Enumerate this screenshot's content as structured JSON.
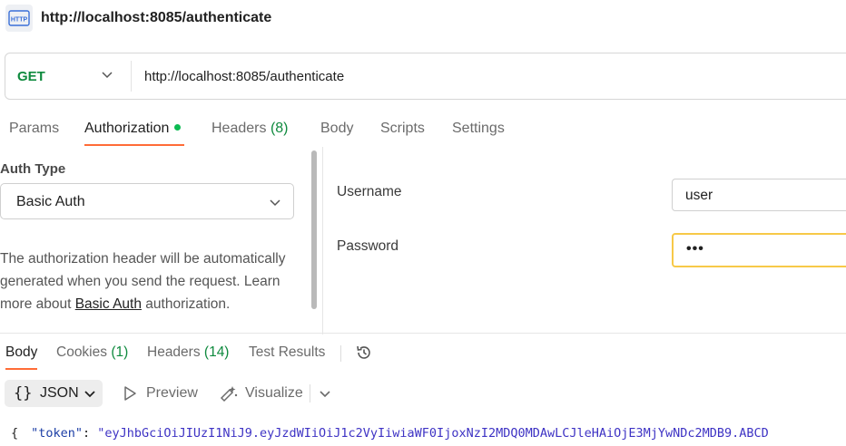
{
  "request": {
    "title": "http://localhost:8085/authenticate",
    "icon": "http-request-icon"
  },
  "urlbar": {
    "method": "GET",
    "url": "http://localhost:8085/authenticate"
  },
  "request_tabs": [
    {
      "label": "Params",
      "count": ""
    },
    {
      "label": "Authorization",
      "count": ""
    },
    {
      "label": "Headers",
      "count": "(8)"
    },
    {
      "label": "Body",
      "count": ""
    },
    {
      "label": "Scripts",
      "count": ""
    },
    {
      "label": "Settings",
      "count": ""
    }
  ],
  "auth": {
    "type_label": "Auth Type",
    "type_value": "Basic Auth",
    "description_before": "The authorization header will be automatically generated when you send the request. Learn more about ",
    "description_link": "Basic Auth",
    "description_after": " authorization.",
    "username_label": "Username",
    "username_value": "user",
    "password_label": "Password",
    "password_value": "•••"
  },
  "response_tabs": [
    {
      "label": "Body",
      "count": ""
    },
    {
      "label": "Cookies",
      "count": "(1)"
    },
    {
      "label": "Headers",
      "count": "(14)"
    },
    {
      "label": "Test Results",
      "count": ""
    }
  ],
  "response_toolbar": {
    "braces": "{}",
    "format": "JSON",
    "preview": "Preview",
    "visualize": "Visualize"
  },
  "response_body": {
    "open_brace": "{",
    "key": "\"token\"",
    "colon": ":",
    "value": "\"eyJhbGciOiJIUzI1NiJ9.eyJzdWIiOiJ1c2VyIiwiaWF0IjoxNzI2MDQ0MDAwLCJleHAiOjE3MjYwNDc2MDB9.ABCD"
  },
  "colors": {
    "accent": "#ff6c37",
    "method_get": "#0f8a3e",
    "status_dot": "#0cbb52",
    "focus_border": "#f7c948"
  }
}
